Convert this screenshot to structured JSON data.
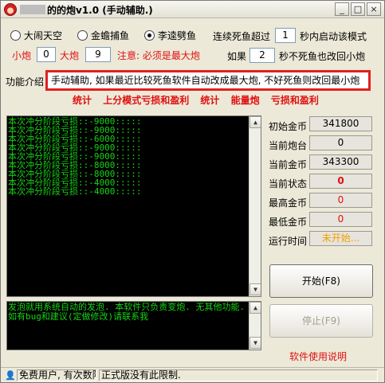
{
  "titlebar": {
    "title": "的的炮v1.0 (手动辅助.)",
    "minimize": "_",
    "maximize": "□",
    "close": "×"
  },
  "modes": [
    {
      "label": "大闹天空",
      "checked": false
    },
    {
      "label": "金蟾捕鱼",
      "checked": false
    },
    {
      "label": "李逵劈鱼",
      "checked": true
    }
  ],
  "settings": {
    "consecutive_death_prefix": "连续死鱼超过",
    "consecutive_death_value": "1",
    "consecutive_death_suffix": "秒内启动该模式",
    "small_cannon_label": "小炮",
    "small_cannon_value": "0",
    "big_cannon_label": "大炮",
    "big_cannon_value": "9",
    "notice": "注意: 必须是最大炮",
    "if_label": "如果",
    "no_death_value": "2",
    "no_death_suffix": "秒不死鱼也改回小炮"
  },
  "intro": {
    "label": "功能介绍",
    "text": "手动辅助, 如果最近比较死鱼软件自动改成最大炮, 不好死鱼则改回最小炮"
  },
  "links": [
    "统计",
    "上分模式亏损和盈利",
    "统计",
    "能量炮",
    "亏损和盈利"
  ],
  "log_lines": [
    "本次冲分阶段亏损::-9000:::::",
    "本次冲分阶段亏损::-9000:::::",
    "本次冲分阶段亏损::-6000:::::",
    "本次冲分阶段亏损::-9000:::::",
    "本次冲分阶段亏损::-9000:::::",
    "本次冲分阶段亏损::-8000:::::",
    "本次冲分阶段亏损::-8000:::::",
    "本次冲分阶段亏损::-4000:::::",
    "本次冲分阶段亏损::-4000:::::"
  ],
  "info_lines": [
    "发泡就用系统自动的发泡. 本软件只负责变炮. 无其他功能.",
    "如有bug和建议(定做修改)请联系我"
  ],
  "stats": {
    "initial_gold_label": "初始金币",
    "initial_gold": "341800",
    "current_turret_label": "当前炮台",
    "current_turret": "0",
    "current_gold_label": "当前金币",
    "current_gold": "343300",
    "current_state_label": "当前状态",
    "current_state": "0",
    "max_gold_label": "最高金币",
    "max_gold": "0",
    "min_gold_label": "最低金币",
    "min_gold": "0",
    "runtime_label": "运行时间",
    "runtime": "未开始..."
  },
  "buttons": {
    "start": "开始(F8)",
    "stop": "停止(F9)"
  },
  "help_link": "软件使用说明",
  "statusbar": {
    "user": "免费用户, 有次数限",
    "message": "正式版没有此限制."
  }
}
